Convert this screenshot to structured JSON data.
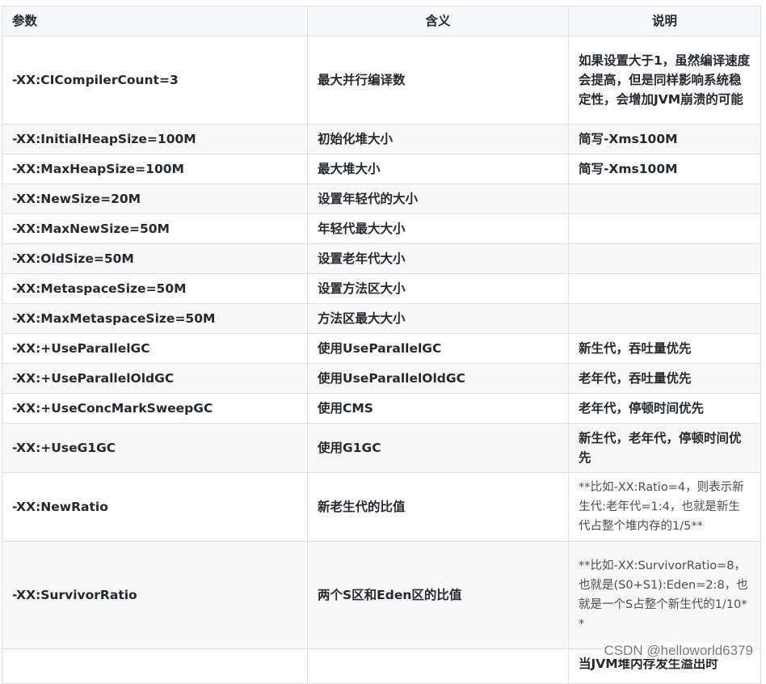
{
  "headers": [
    "参数",
    "含义",
    "说明"
  ],
  "rows": [
    {
      "param": "-XX:CICompilerCount=3",
      "meaning": "最大并行编译数",
      "note": "如果设置大于1，虽然编译速度会提高，但是同样影响系统稳定性，会增加JVM崩溃的可能"
    },
    {
      "param": "-XX:InitialHeapSize=100M",
      "meaning": "初始化堆大小",
      "note": "简写-Xms100M"
    },
    {
      "param": "-XX:MaxHeapSize=100M",
      "meaning": "最大堆大小",
      "note": "简写-Xms100M"
    },
    {
      "param": "-XX:NewSize=20M",
      "meaning": "设置年轻代的大小",
      "note": ""
    },
    {
      "param": "-XX:MaxNewSize=50M",
      "meaning": "年轻代最大大小",
      "note": ""
    },
    {
      "param": "-XX:OldSize=50M",
      "meaning": "设置老年代大小",
      "note": ""
    },
    {
      "param": "-XX:MetaspaceSize=50M",
      "meaning": "设置方法区大小",
      "note": ""
    },
    {
      "param": "-XX:MaxMetaspaceSize=50M",
      "meaning": "方法区最大大小",
      "note": ""
    },
    {
      "param": "-XX:+UseParallelGC",
      "meaning": "使用UseParallelGC",
      "note": "新生代，吞吐量优先"
    },
    {
      "param": "-XX:+UseParallelOldGC",
      "meaning": "使用UseParallelOldGC",
      "note": "老年代，吞吐量优先"
    },
    {
      "param": "-XX:+UseConcMarkSweepGC",
      "meaning": "使用CMS",
      "note": "老年代，停顿时间优先"
    },
    {
      "param": "-XX:+UseG1GC",
      "meaning": "使用G1GC",
      "note": "新生代，老年代，停顿时间优先"
    },
    {
      "param": "-XX:NewRatio",
      "meaning": "新老生代的比值",
      "note": "**比如-XX:Ratio=4，则表示新生代:老年代=1:4，也就是新生代占整个堆内存的1/5**"
    },
    {
      "param": "-XX:SurvivorRatio",
      "meaning": "两个S区和Eden区的比值",
      "note": "**比如-XX:SurvivorRatio=8，也就是(S0+S1):Eden=2:8，也就是一个S占整个新生代的1/10**"
    },
    {
      "param": "",
      "meaning": "",
      "note": "当JVM堆内存发生溢出时"
    }
  ],
  "watermark": "CSDN @helloworld6379"
}
